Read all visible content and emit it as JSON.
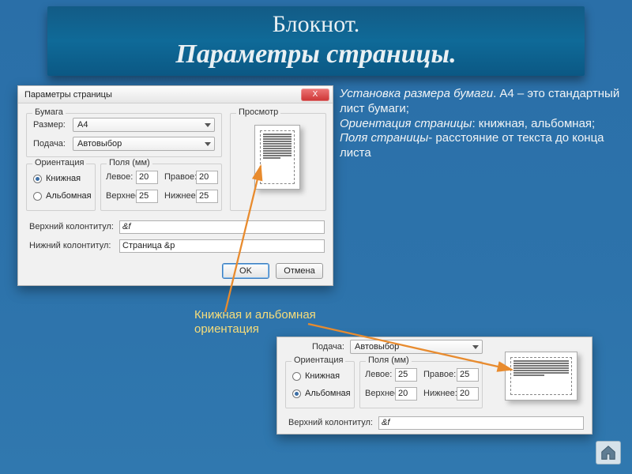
{
  "banner": {
    "line1": "Блокнот.",
    "line2": "Параметры страницы."
  },
  "desc": {
    "p1_em": "Установка размера бумаги",
    "p1_rest": ". А4 – это стандартный лист бумаги;",
    "p2_em": "Ориентация страницы",
    "p2_rest": ": книжная, альбомная;",
    "p3_em": "Поля страницы",
    "p3_rest": "- расстояние от текста до конца листа"
  },
  "anno2": {
    "l1": "Книжная и альбомная",
    "l2": "ориентация"
  },
  "dlg1": {
    "title": "Параметры страницы",
    "groups": {
      "paper": "Бумага",
      "orient": "Ориентация",
      "margins": "Поля (мм)",
      "preview": "Просмотр"
    },
    "labels": {
      "size": "Размер:",
      "feed": "Подача:",
      "left": "Левое:",
      "right": "Правое:",
      "top": "Верхнее:",
      "bottom": "Нижнее:",
      "header": "Верхний колонтитул:",
      "footer": "Нижний колонтитул:"
    },
    "values": {
      "size": "A4",
      "feed": "Автовыбор",
      "left": "20",
      "right": "20",
      "top": "25",
      "bottom": "25",
      "header": "&f",
      "footer": "Страница &p"
    },
    "orient": {
      "portrait": "Книжная",
      "landscape": "Альбомная"
    },
    "buttons": {
      "ok": "OK",
      "cancel": "Отмена"
    },
    "close_x": "X"
  },
  "dlg2": {
    "labels": {
      "feed": "Подача:",
      "left": "Левое:",
      "right": "Правое:",
      "top": "Верхнее:",
      "bottom": "Нижнее:",
      "header": "Верхний колонтитул:"
    },
    "groups": {
      "orient": "Ориентация",
      "margins": "Поля (мм)"
    },
    "values": {
      "feed": "Автовыбор",
      "left": "25",
      "right": "25",
      "top": "20",
      "bottom": "20",
      "header": "&f"
    },
    "orient": {
      "portrait": "Книжная",
      "landscape": "Альбомная"
    }
  },
  "icons": {
    "close": "close-icon",
    "home": "home-icon",
    "chevron": "chevron-down-icon"
  }
}
